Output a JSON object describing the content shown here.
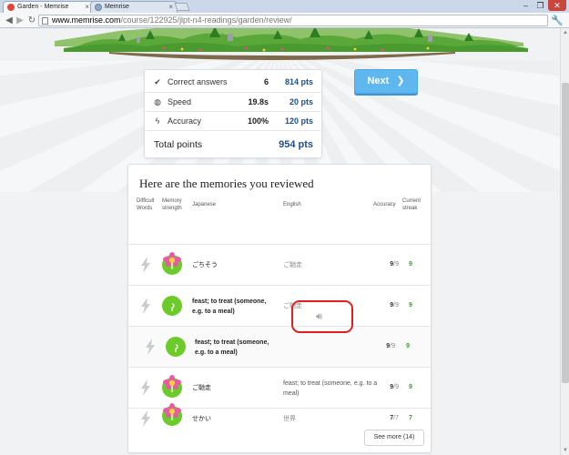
{
  "browser": {
    "tabs": [
      {
        "title": "Garden - Memrise",
        "active": true
      },
      {
        "title": "Memrise",
        "active": false
      }
    ],
    "url_host": "www.memrise.com",
    "url_path": "/course/122925/jlpt-n4-readings/garden/review/",
    "window_minimize": "‒",
    "window_maximize": "❐",
    "window_close": "✕"
  },
  "stats": {
    "rows": [
      {
        "icon": "check-icon",
        "label": "Correct answers",
        "value": "6",
        "points": "814 pts"
      },
      {
        "icon": "stopwatch-icon",
        "label": "Speed",
        "value": "19.8s",
        "points": "20 pts"
      },
      {
        "icon": "bolt-icon",
        "label": "Accuracy",
        "value": "100%",
        "points": "120 pts"
      }
    ],
    "total_label": "Total points",
    "total_value": "954 pts"
  },
  "next_button": "Next",
  "review": {
    "title": "Here are the memories you reviewed",
    "columns": {
      "difficult": "Difficult Words",
      "memory": "Memory strength",
      "japanese": "Japanese",
      "english": "English",
      "accuracy": "Accuracy",
      "streak": "Current streak"
    },
    "rows": [
      {
        "japanese": "ごちそう",
        "english": "ご馳走",
        "accuracy": "9",
        "total": "/9",
        "streak": "9",
        "plant": "flower"
      },
      {
        "japanese": "feast; to treat (someone, e.g. to a meal)",
        "english": "ご馳走",
        "accuracy": "9",
        "total": "/9",
        "streak": "9",
        "plant": "sprout"
      },
      {
        "japanese": "feast; to treat (someone, e.g. to a meal)",
        "english": "",
        "accuracy": "9",
        "total": "/9",
        "streak": "9",
        "plant": "sprout"
      },
      {
        "japanese": "ご馳走",
        "english": "feast; to treat (someone, e.g. to a meal)",
        "accuracy": "9",
        "total": "/9",
        "streak": "9",
        "plant": "flower"
      },
      {
        "japanese": "せかい",
        "english": "世界",
        "accuracy": "7",
        "total": "/7",
        "streak": "7",
        "plant": "flower"
      }
    ],
    "see_more": "See more (14)"
  },
  "colors": {
    "accent": "#5eb7ee",
    "points": "#1e4f8c",
    "streak": "#3a9e2a",
    "highlight": "#e02020"
  }
}
